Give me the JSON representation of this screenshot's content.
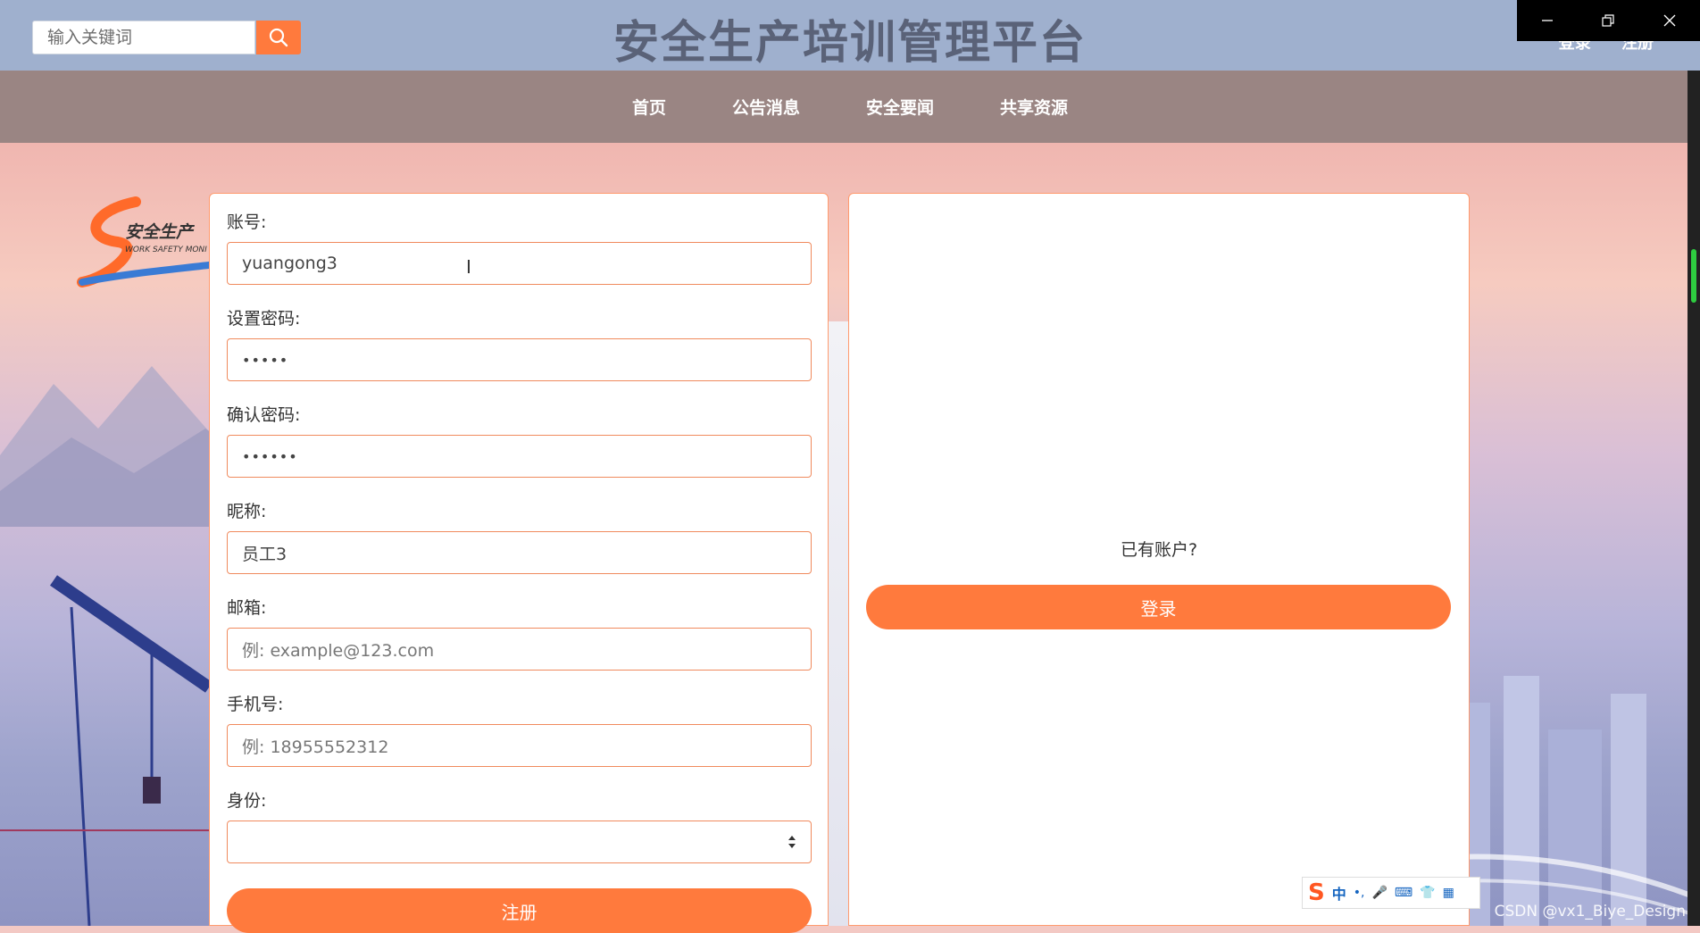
{
  "header": {
    "search_placeholder": "输入关键词",
    "site_title": "安全生产培训管理平台",
    "auth_links": [
      "登录",
      "注册"
    ]
  },
  "nav": {
    "items": [
      "首页",
      "公告消息",
      "安全要闻",
      "共享资源"
    ]
  },
  "logo": {
    "text_cn": "安全生产",
    "text_en": "WORK SAFETY MONI"
  },
  "form": {
    "account": {
      "label": "账号:",
      "value": "yuangong3"
    },
    "password": {
      "label": "设置密码:",
      "value": "•••••"
    },
    "confirm_password": {
      "label": "确认密码:",
      "value": "••••••"
    },
    "nickname": {
      "label": "昵称:",
      "value": "员工3"
    },
    "email": {
      "label": "邮箱:",
      "placeholder": "例: example@123.com"
    },
    "phone": {
      "label": "手机号:",
      "placeholder": "例: 18955552312"
    },
    "role": {
      "label": "身份:",
      "value": ""
    },
    "register_label": "注册"
  },
  "login_panel": {
    "prompt": "已有账户?",
    "login_label": "登录"
  },
  "ime": {
    "logo": "S",
    "lang": "中"
  },
  "watermark": "CSDN @vx1_Biye_Design",
  "colors": {
    "accent": "#ff7a3d",
    "header_bg": "#9fb0ce",
    "nav_bg": "#9a8583",
    "input_border": "#f08a5d"
  }
}
